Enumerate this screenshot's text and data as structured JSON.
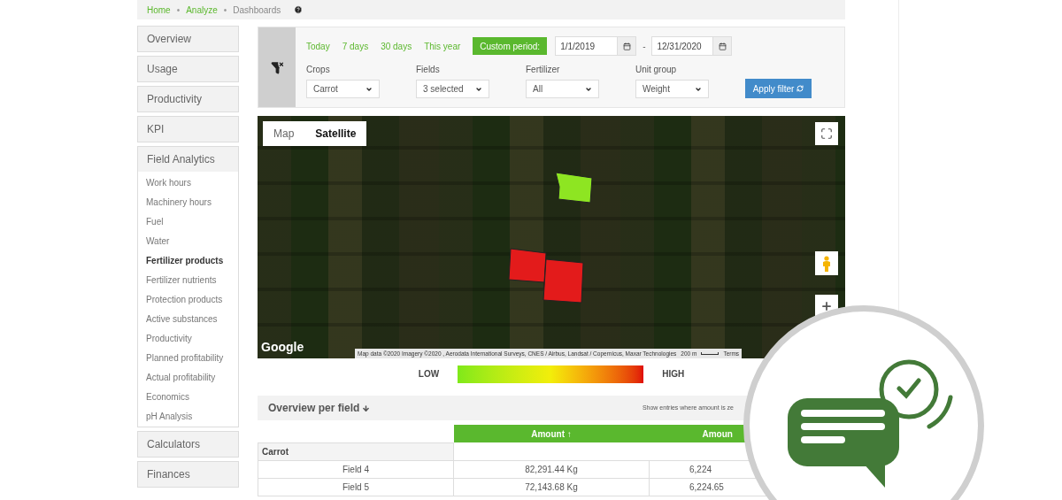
{
  "breadcrumb_separator": "•",
  "breadcrumb": [
    {
      "label": "Home",
      "current": false
    },
    {
      "label": "Analyze",
      "current": false
    },
    {
      "label": "Dashboards",
      "current": true
    }
  ],
  "sidebar": [
    {
      "label": "Overview",
      "expanded": false
    },
    {
      "label": "Usage",
      "expanded": false
    },
    {
      "label": "Productivity",
      "expanded": false
    },
    {
      "label": "KPI",
      "expanded": false
    },
    {
      "label": "Field Analytics",
      "expanded": true,
      "children": [
        {
          "label": "Work hours",
          "selected": false
        },
        {
          "label": "Machinery hours",
          "selected": false
        },
        {
          "label": "Fuel",
          "selected": false
        },
        {
          "label": "Water",
          "selected": false
        },
        {
          "label": "Fertilizer products",
          "selected": true
        },
        {
          "label": "Fertilizer nutrients",
          "selected": false
        },
        {
          "label": "Protection products",
          "selected": false
        },
        {
          "label": "Active substances",
          "selected": false
        },
        {
          "label": "Productivity",
          "selected": false
        },
        {
          "label": "Planned profitability",
          "selected": false
        },
        {
          "label": "Actual profitability",
          "selected": false
        },
        {
          "label": "Economics",
          "selected": false
        },
        {
          "label": "pH Analysis",
          "selected": false
        }
      ]
    },
    {
      "label": "Calculators",
      "expanded": false
    },
    {
      "label": "Finances",
      "expanded": false
    }
  ],
  "filter": {
    "periods": [
      {
        "label": "Today",
        "selected": false
      },
      {
        "label": "7 days",
        "selected": false
      },
      {
        "label": "30 days",
        "selected": false
      },
      {
        "label": "This year",
        "selected": false
      },
      {
        "label": "Custom period:",
        "selected": true
      }
    ],
    "date_from": "1/1/2019",
    "separator": "-",
    "date_to": "12/31/2020",
    "selects": [
      {
        "label": "Crops",
        "value": "Carrot"
      },
      {
        "label": "Fields",
        "value": "3 selected"
      },
      {
        "label": "Fertilizer",
        "value": "All"
      },
      {
        "label": "Unit group",
        "value": "Weight"
      }
    ],
    "apply_button": "Apply filter"
  },
  "map": {
    "view_toggle": [
      {
        "label": "Map",
        "selected": false
      },
      {
        "label": "Satellite",
        "selected": true
      }
    ],
    "fields": [
      {
        "color": "#8ee522"
      },
      {
        "color": "#e31b1b"
      },
      {
        "color": "#e31b1b"
      }
    ],
    "logo": "Google",
    "attribution": "Map data ©2020 Imagery ©2020 , Aerodata International Surveys, CNES / Airbus, Landsat / Copernicus, Maxar Technologies",
    "scale": "200 m",
    "terms": "Terms"
  },
  "legend": {
    "low": "LOW",
    "high": "HIGH"
  },
  "overview": {
    "title": "Overview per field",
    "note": "Show entries where amount is ze"
  },
  "table": {
    "columns": [
      "Amount ↑",
      "Amoun"
    ],
    "groups": [
      {
        "label": "Carrot",
        "rows": [
          {
            "name": "Field 4",
            "values": [
              "82,291.44 Kg",
              "6,224"
            ]
          },
          {
            "name": "Field 5",
            "values": [
              "72,143.68 Kg",
              "6,224.65"
            ]
          }
        ]
      }
    ]
  }
}
